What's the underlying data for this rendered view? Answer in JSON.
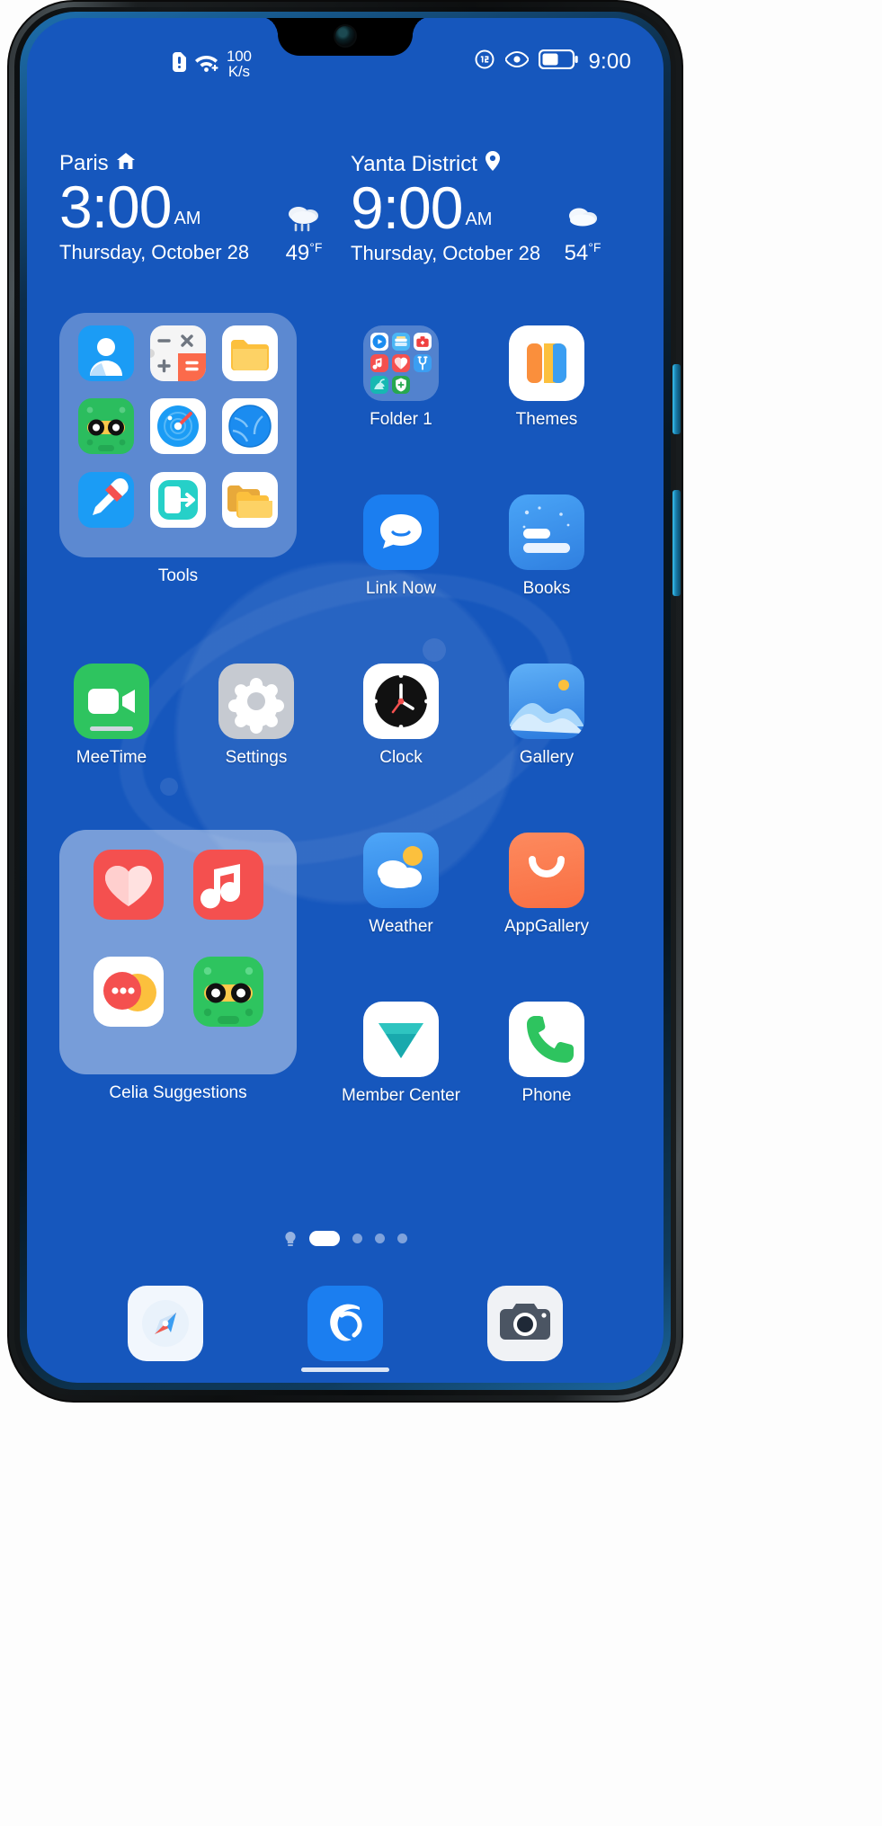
{
  "device": {
    "name": "huawei-phone",
    "frame_color": "#16181a"
  },
  "statusbar": {
    "icons_left": [
      "alert-sim-icon",
      "wifi-icon"
    ],
    "network_speed": "100",
    "network_speed_unit": "K/s",
    "icons_right": [
      "vibrate-icon",
      "eye-comfort-icon",
      "battery-icon"
    ],
    "time": "9:00"
  },
  "clock_widget": {
    "left": {
      "city": "Paris",
      "city_icon": "home-icon",
      "time": "3:00",
      "ampm": "AM",
      "date": "Thursday, October 28",
      "weather_icon": "cloudy-icon",
      "temperature": "49",
      "temperature_unit": "°F"
    },
    "right": {
      "city": "Yanta District",
      "city_icon": "location-pin-icon",
      "time": "9:00",
      "ampm": "AM",
      "date": "Thursday, October 28",
      "weather_icon": "cloud-icon",
      "temperature": "54",
      "temperature_unit": "°F"
    }
  },
  "home_screen": {
    "folders": {
      "tools": {
        "label": "Tools",
        "apps": [
          "contacts-icon",
          "calculator-icon",
          "files-icon",
          "recorder-icon",
          "compass-icon",
          "browser-icon",
          "hinote-icon",
          "app-transfer-icon",
          "file-manager-icon"
        ]
      },
      "folder1": {
        "label": "Folder 1",
        "apps": [
          "video-icon",
          "wallet-icon",
          "first-aid-icon",
          "music-icon",
          "health-icon",
          "toolbox-icon",
          "pet-icon",
          "security-icon"
        ]
      },
      "celia": {
        "label": "Celia Suggestions",
        "apps": [
          "health-icon",
          "music-icon",
          "messages-icon",
          "recorder-icon"
        ]
      }
    },
    "apps": [
      {
        "label": "Themes",
        "icon": "themes-icon"
      },
      {
        "label": "Link Now",
        "icon": "link-now-icon"
      },
      {
        "label": "Books",
        "icon": "books-icon"
      },
      {
        "label": "MeeTime",
        "icon": "meetime-icon"
      },
      {
        "label": "Settings",
        "icon": "settings-icon"
      },
      {
        "label": "Clock",
        "icon": "clock-icon"
      },
      {
        "label": "Gallery",
        "icon": "gallery-icon"
      },
      {
        "label": "Weather",
        "icon": "weather-icon"
      },
      {
        "label": "AppGallery",
        "icon": "appgallery-icon"
      },
      {
        "label": "Member Center",
        "icon": "member-center-icon"
      },
      {
        "label": "Phone",
        "icon": "phone-icon"
      }
    ],
    "page_indicator": {
      "total": 4,
      "active_index": 0,
      "has_bulb": true
    },
    "dock": [
      {
        "label": "Browser",
        "icon": "browser-icon"
      },
      {
        "label": "Celia",
        "icon": "celia-icon"
      },
      {
        "label": "Camera",
        "icon": "camera-icon"
      }
    ]
  },
  "colors": {
    "wallpaper": "#1657bd",
    "folder_bg": "rgba(255,255,255,.30)",
    "accent_blue": "#1a8cff",
    "green": "#2ec45f",
    "red": "#f4504f",
    "orange": "#fb7a51"
  }
}
